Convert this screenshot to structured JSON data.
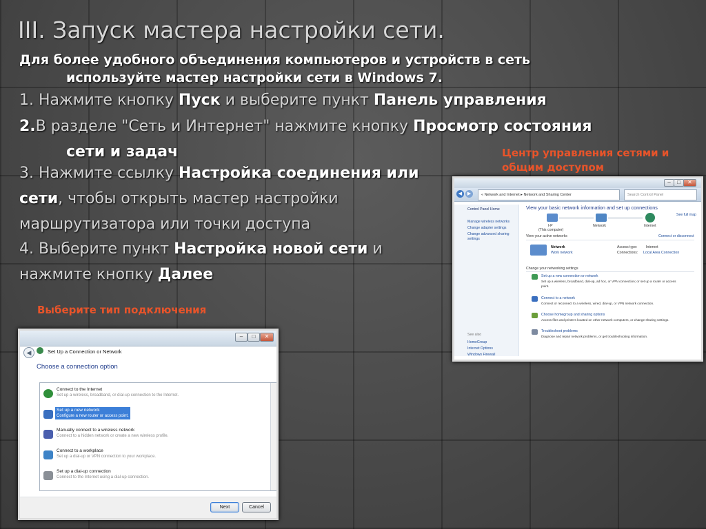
{
  "title": "III. Запуск мастера настройки сети.",
  "intro": {
    "line1": "Для более удобного объединения компьютеров и устройств в сеть",
    "line2": "используйте мастер настройки сети в Windows 7."
  },
  "steps": {
    "s1": {
      "num": "1.",
      "text1": " Нажмите кнопку ",
      "b1": "Пуск",
      "text2": " и выберите пункт ",
      "b2": "Панель управления"
    },
    "s2": {
      "num": "2.",
      "text1": "В разделе \"Сеть и Интернет\" нажмите кнопку ",
      "b1": "Просмотр состояния",
      "b1b": "сети и задач"
    },
    "s3": {
      "num": "3.",
      "text1": " Нажмите ссылку ",
      "b1": "Настройка соединения или",
      "b2": "сети",
      "text2": ", чтобы открыть мастер настройки",
      "text3": "маршрутизатора или точки доступа"
    },
    "s4": {
      "num": "4.",
      "text1": " Выберите пункт ",
      "b1": "Настройка новой сети",
      "text2": " и",
      "text3": "нажмите кнопку ",
      "b2": "Далее"
    }
  },
  "captions": {
    "nsc_line1": "Центр управления сетями и",
    "nsc_line2": "общим доступом",
    "type": "Выберите тип подключения"
  },
  "dialog": {
    "title": "Set Up a Connection or Network",
    "heading": "Choose a connection option",
    "options": [
      {
        "label": "Connect to the Internet",
        "desc": "Set up a wireless, broadband, or dial-up connection to the Internet.",
        "icon_color": "#2f8f3a"
      },
      {
        "label": "Set up a new network",
        "desc": "Configure a new router or access point.",
        "icon_color": "#3a6fbf"
      },
      {
        "label": "Manually connect to a wireless network",
        "desc": "Connect to a hidden network or create a new wireless profile.",
        "icon_color": "#4a5fae"
      },
      {
        "label": "Connect to a workplace",
        "desc": "Set up a dial-up or VPN connection to your workplace.",
        "icon_color": "#3d83c7"
      },
      {
        "label": "Set up a dial-up connection",
        "desc": "Connect to the Internet using a dial-up connection.",
        "icon_color": "#8a8f96"
      }
    ],
    "next": "Next",
    "cancel": "Cancel"
  },
  "nsc": {
    "breadcrumb": "« Network and Internet ▸ Network and Sharing Center",
    "search": "Search Control Panel",
    "side_home": "Control Panel Home",
    "side_links": [
      "Manage wireless networks",
      "Change adapter settings",
      "Change advanced sharing",
      "settings"
    ],
    "see_also": "See also",
    "see_also_links": [
      "HomeGroup",
      "Internet Options",
      "Windows Firewall"
    ],
    "heading": "View your basic network information and set up connections",
    "see_full_map": "See full map",
    "node_pc": "I-P",
    "node_pc_sub": "(This computer)",
    "node_network": "Network",
    "node_internet": "Internet",
    "active_networks": "View your active networks",
    "connect_disconnect": "Connect or disconnect",
    "net_name": "Network",
    "net_type": "Work network",
    "access_type_label": "Access type:",
    "access_type_value": "Internet",
    "connections_label": "Connections:",
    "connections_value": "Local Area Connection",
    "change_settings": "Change your networking settings",
    "tasks": [
      {
        "link": "Set up a new connection or network",
        "desc": "Set up a wireless, broadband, dial-up, ad hoc, or VPN connection; or set up a router or access",
        "desc2": "point."
      },
      {
        "link": "Connect to a network",
        "desc": "Connect or reconnect to a wireless, wired, dial-up, or VPN network connection.",
        "desc2": ""
      },
      {
        "link": "Choose homegroup and sharing options",
        "desc": "Access files and printers located on other network computers, or change sharing settings.",
        "desc2": ""
      },
      {
        "link": "Troubleshoot problems",
        "desc": "Diagnose and repair network problems, or get troubleshooting information.",
        "desc2": ""
      }
    ]
  }
}
